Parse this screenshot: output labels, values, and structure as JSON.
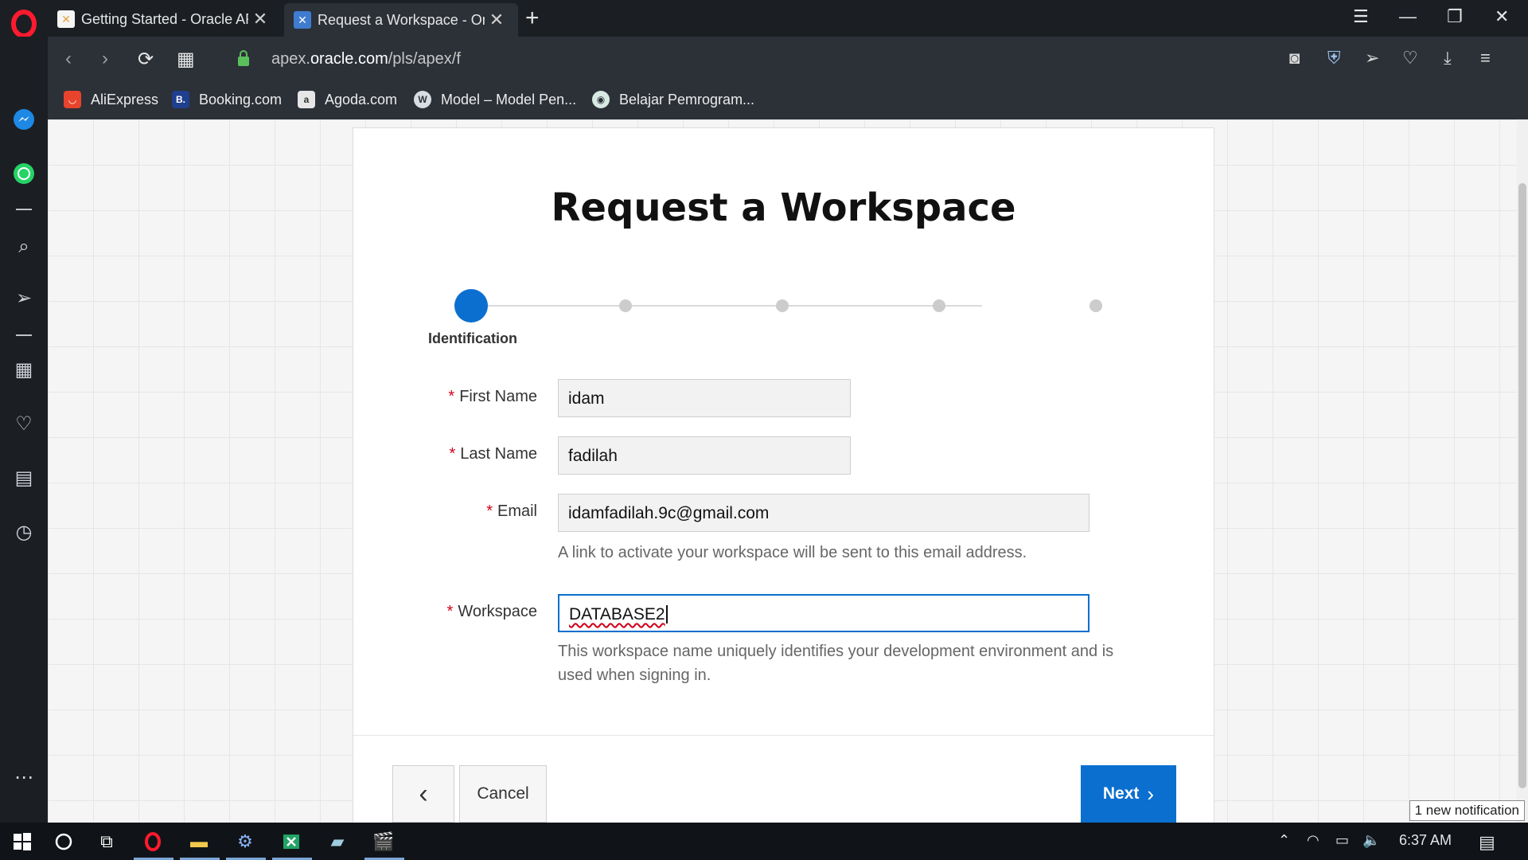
{
  "browser": {
    "tabs": [
      {
        "title": "Getting Started - Oracle AP"
      },
      {
        "title": "Request a Workspace - Ora"
      }
    ],
    "url_prefix": "apex.",
    "url_domain": "oracle.com",
    "url_path": "/pls/apex/f",
    "bookmarks": [
      {
        "label": "AliExpress"
      },
      {
        "label": "Booking.com"
      },
      {
        "label": "Agoda.com"
      },
      {
        "label": "Model – Model Pen..."
      },
      {
        "label": "Belajar Pemrogram..."
      }
    ]
  },
  "page": {
    "title": "Request a Workspace",
    "wizard": {
      "current_step_label": "Identification",
      "total_steps": 5,
      "current_step": 1
    },
    "fields": {
      "first_name": {
        "label": "First Name",
        "value": "idam"
      },
      "last_name": {
        "label": "Last Name",
        "value": "fadilah"
      },
      "email": {
        "label": "Email",
        "value": "idamfadilah.9c@gmail.com",
        "help": "A link to activate your workspace will be sent to this email address."
      },
      "workspace": {
        "label": "Workspace",
        "value": "DATABASE2",
        "help_line1": "This workspace name uniquely identifies your development environment and is",
        "help_line2": "used when signing in."
      }
    },
    "required_marker": "*",
    "buttons": {
      "back": "‹",
      "cancel": "Cancel",
      "next": "Next"
    }
  },
  "notification": "1 new notification",
  "taskbar": {
    "time": "6:37 AM"
  },
  "colors": {
    "accent": "#0b6fcf",
    "required": "#d0021b"
  }
}
